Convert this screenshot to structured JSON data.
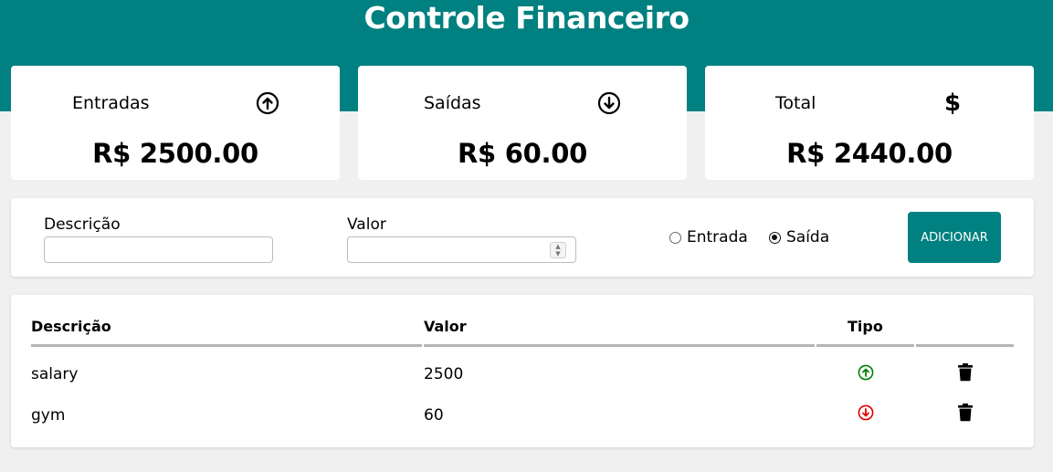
{
  "app": {
    "title": "Controle Financeiro"
  },
  "summary": {
    "income": {
      "label": "Entradas",
      "value": "R$ 2500.00",
      "icon": "arrow-up-circle-icon"
    },
    "expense": {
      "label": "Saídas",
      "value": "R$ 60.00",
      "icon": "arrow-down-circle-icon"
    },
    "total": {
      "label": "Total",
      "value": "R$ 2440.00",
      "icon": "dollar-icon",
      "icon_glyph": "$"
    }
  },
  "form": {
    "description_label": "Descrição",
    "description_value": "",
    "amount_label": "Valor",
    "amount_value": "",
    "type_options": [
      {
        "label": "Entrada",
        "checked": false
      },
      {
        "label": "Saída",
        "checked": true
      }
    ],
    "add_button_label": "ADICIONAR"
  },
  "table": {
    "headers": [
      "Descrição",
      "Valor",
      "Tipo",
      ""
    ],
    "rows": [
      {
        "description": "salary",
        "amount": "2500",
        "type": "income",
        "type_color": "#008000"
      },
      {
        "description": "gym",
        "amount": "60",
        "type": "expense",
        "type_color": "#e00000"
      }
    ]
  },
  "colors": {
    "brand": "#008080",
    "income": "#008000",
    "expense": "#e00000"
  }
}
